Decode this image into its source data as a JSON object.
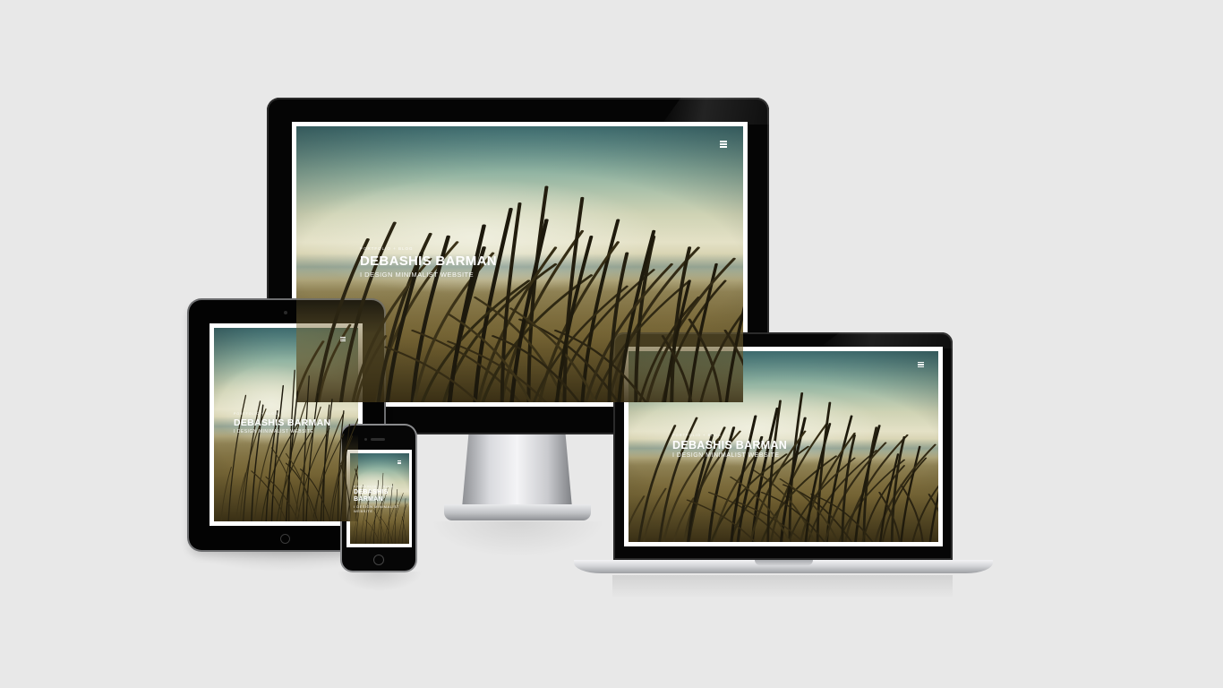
{
  "site": {
    "kicker": "PORTFOLIO + BLOG",
    "name": "DEBASHIS BARMAN",
    "tagline": "I DESIGN MINIMALIST WEBSITE"
  },
  "devices": [
    "monitor",
    "tablet",
    "phone",
    "laptop"
  ],
  "icons": {
    "menu": "hamburger-menu-icon"
  },
  "colors": {
    "background": "#e8e8e8",
    "bezel": "#050505",
    "hero_text": "#ffffff"
  }
}
